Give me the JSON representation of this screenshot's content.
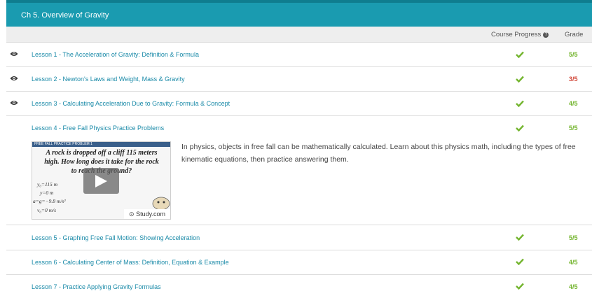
{
  "chapter": {
    "title": "Ch 5. Overview of Gravity"
  },
  "columns": {
    "progress_label": "Course Progress",
    "grade_label": "Grade",
    "help_icon": "question-icon"
  },
  "lessons": [
    {
      "label": "Lesson 1 - The Acceleration of Gravity: Definition & Formula",
      "grade": "5/5",
      "viewed": true,
      "complete": true
    },
    {
      "label": "Lesson 2 - Newton's Laws and Weight, Mass & Gravity",
      "grade": "3/5",
      "viewed": true,
      "complete": true
    },
    {
      "label": "Lesson 3 - Calculating Acceleration Due to Gravity: Formula & Concept",
      "grade": "4/5",
      "viewed": true,
      "complete": true
    },
    {
      "label": "Lesson 4 - Free Fall Physics Practice Problems",
      "grade": "5/5",
      "viewed": false,
      "complete": true
    },
    {
      "label": "Lesson 5 - Graphing Free Fall Motion: Showing Acceleration",
      "grade": "5/5",
      "viewed": false,
      "complete": true
    },
    {
      "label": "Lesson 6 - Calculating Center of Mass: Definition, Equation & Example",
      "grade": "4/5",
      "viewed": false,
      "complete": true
    },
    {
      "label": "Lesson 7 - Practice Applying Gravity Formulas",
      "grade": "4/5",
      "viewed": false,
      "complete": true
    }
  ],
  "expanded": {
    "thumbnail": {
      "banner": "FREE FALL PRACTICE PROBLEM 1",
      "question_line1": "A rock is dropped off a cliff 115 meters",
      "question_line2": "high. How long does it take for the rock",
      "question_line3": "to reach the ground?",
      "eq1": "y₀=115 m",
      "eq2": "y=0 m",
      "eq3": "a=g=−9.8 m/s²",
      "eq4": "v₀=0 m/s",
      "brand": "Study.com"
    },
    "description_line1": "In physics, objects in free fall can be mathematically calculated. Learn about this physics math, including the types of free",
    "description_line2": "kinematic equations, then practice answering them."
  },
  "colors": {
    "header": "#1a9bb0",
    "link": "#1a8aa8",
    "check": "#74b52f",
    "grade_full": "#74b52f",
    "grade_low": "#d2483a"
  }
}
